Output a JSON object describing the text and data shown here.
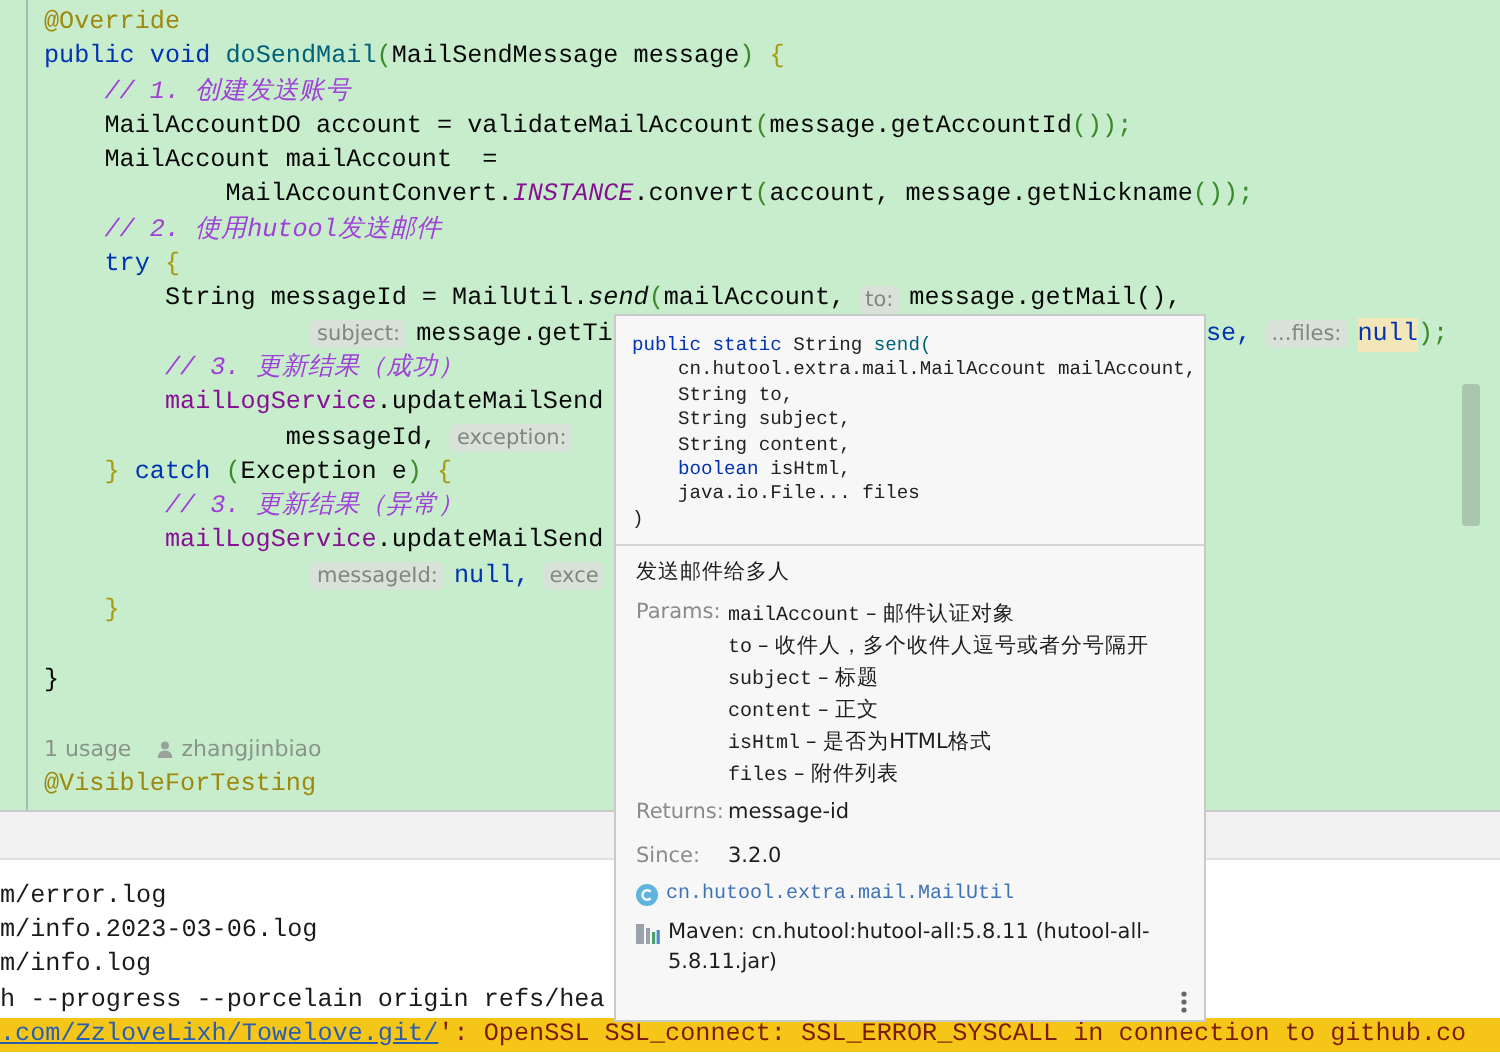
{
  "editor": {
    "lines": [
      {
        "kind": "top",
        "tokens": [
          {
            "kind": "annotation",
            "text": "@Override"
          }
        ]
      },
      {
        "kind": "top",
        "tokens": [
          {
            "kind": "keyword",
            "text": "public void "
          },
          {
            "kind": "method",
            "text": "doSendMail"
          },
          {
            "kind": "paren",
            "text": "("
          },
          {
            "kind": "plain",
            "text": "MailSendMessage message"
          },
          {
            "kind": "paren",
            "text": ")"
          },
          {
            "kind": "brace",
            "text": " {"
          }
        ]
      },
      {
        "kind": "block",
        "tokens": [
          {
            "kind": "comment",
            "text": "// 1. 创建发送账号"
          }
        ]
      },
      {
        "kind": "block",
        "tokens": [
          {
            "kind": "plain",
            "text": "MailAccountDO account = validateMailAccount"
          },
          {
            "kind": "paren",
            "text": "("
          },
          {
            "kind": "plain",
            "text": "message.getAccountId"
          },
          {
            "kind": "paren",
            "text": "());"
          }
        ]
      },
      {
        "kind": "block",
        "tokens": [
          {
            "kind": "plain",
            "text": "MailAccount mailAccount  ="
          }
        ]
      },
      {
        "kind": "continuation",
        "tokens": [
          {
            "kind": "plain",
            "text": "MailAccountConvert."
          },
          {
            "kind": "static",
            "text": "INSTANCE"
          },
          {
            "kind": "plain",
            "text": ".convert"
          },
          {
            "kind": "paren",
            "text": "("
          },
          {
            "kind": "plain",
            "text": "account, message.getNickname"
          },
          {
            "kind": "paren",
            "text": "());"
          }
        ]
      },
      {
        "kind": "block",
        "tokens": [
          {
            "kind": "comment",
            "text": "// 2. 使用hutool发送邮件"
          }
        ]
      },
      {
        "kind": "block",
        "tokens": [
          {
            "kind": "keyword",
            "text": "try"
          },
          {
            "kind": "brace",
            "text": " {"
          }
        ]
      },
      {
        "kind": "nested",
        "tokens": [
          {
            "kind": "plain",
            "text": "String messageId = MailUtil."
          },
          {
            "kind": "call",
            "text": "send"
          },
          {
            "kind": "paren",
            "text": "("
          },
          {
            "kind": "plain",
            "text": "mailAccount,"
          },
          {
            "kind": "hint",
            "text": "to:"
          },
          {
            "kind": "plain",
            "text": "message.getMail(),"
          }
        ]
      },
      {
        "kind": "hinted",
        "tokens": [
          {
            "kind": "hint",
            "text": "subject:"
          },
          {
            "kind": "plain",
            "text": "message.getTi"
          }
        ],
        "tail": [
          {
            "kind": "keyword",
            "text": "se,"
          },
          {
            "kind": "hint",
            "text": "...files:"
          },
          {
            "kind": "null",
            "text": "null"
          },
          {
            "kind": "paren",
            "text": ");"
          }
        ]
      },
      {
        "kind": "nested",
        "tokens": [
          {
            "kind": "comment",
            "text": "// 3. 更新结果（成功）"
          }
        ]
      },
      {
        "kind": "nested",
        "tokens": [
          {
            "kind": "field",
            "text": "mailLogService"
          },
          {
            "kind": "plain",
            "text": ".updateMailSend"
          }
        ]
      },
      {
        "kind": "wrapped",
        "tokens": [
          {
            "kind": "plain",
            "text": "messageId,"
          },
          {
            "kind": "hint",
            "text": "exception:"
          }
        ]
      },
      {
        "kind": "block",
        "tokens": [
          {
            "kind": "brace",
            "text": "} "
          },
          {
            "kind": "keyword",
            "text": "catch "
          },
          {
            "kind": "paren",
            "text": "("
          },
          {
            "kind": "plain",
            "text": "Exception e"
          },
          {
            "kind": "paren",
            "text": ")"
          },
          {
            "kind": "brace",
            "text": " {"
          }
        ]
      },
      {
        "kind": "nested",
        "tokens": [
          {
            "kind": "comment",
            "text": "// 3. 更新结果（异常）"
          }
        ]
      },
      {
        "kind": "nested",
        "tokens": [
          {
            "kind": "field",
            "text": "mailLogService"
          },
          {
            "kind": "plain",
            "text": ".updateMailSend"
          }
        ]
      },
      {
        "kind": "hinted",
        "tokens": [
          {
            "kind": "hint",
            "text": "messageId:"
          },
          {
            "kind": "keyword",
            "text": "null,"
          },
          {
            "kind": "hint",
            "text": "exce"
          }
        ]
      },
      {
        "kind": "block",
        "tokens": [
          {
            "kind": "brace",
            "text": "}"
          }
        ]
      },
      {
        "kind": "blank"
      },
      {
        "kind": "top",
        "tokens": [
          {
            "kind": "plain",
            "text": "}"
          }
        ]
      },
      {
        "kind": "blank"
      },
      {
        "kind": "usage",
        "usage": "1 usage",
        "author": "zhangjinbiao"
      },
      {
        "kind": "top",
        "tokens": [
          {
            "kind": "annotation",
            "text": "@VisibleForTesting"
          }
        ]
      }
    ]
  },
  "doc_popup": {
    "signature": [
      {
        "kind": "top",
        "tokens": [
          {
            "kind": "keyword",
            "text": "public static "
          },
          {
            "kind": "plain",
            "text": "String "
          },
          {
            "kind": "method",
            "text": "send("
          }
        ]
      },
      {
        "kind": "block",
        "tokens": [
          {
            "kind": "plain",
            "text": "cn.hutool.extra.mail.MailAccount mailAccount,"
          }
        ]
      },
      {
        "kind": "block",
        "tokens": [
          {
            "kind": "plain",
            "text": "String to,"
          }
        ]
      },
      {
        "kind": "block",
        "tokens": [
          {
            "kind": "plain",
            "text": "String subject,"
          }
        ]
      },
      {
        "kind": "block",
        "tokens": [
          {
            "kind": "plain",
            "text": "String content,"
          }
        ]
      },
      {
        "kind": "block",
        "tokens": [
          {
            "kind": "keyword",
            "text": "boolean "
          },
          {
            "kind": "plain",
            "text": "isHtml,"
          }
        ]
      },
      {
        "kind": "block",
        "tokens": [
          {
            "kind": "plain",
            "text": "java.io.File... files"
          }
        ]
      },
      {
        "kind": "top",
        "tokens": [
          {
            "kind": "plain",
            "text": ")"
          }
        ]
      }
    ],
    "description": "发送邮件给多人",
    "params_label": "Params:",
    "params": [
      {
        "name": "mailAccount",
        "description": "– 邮件认证对象"
      },
      {
        "name": "to",
        "description": "– 收件人，多个收件人逗号或者分号隔开"
      },
      {
        "name": "subject",
        "description": "– 标题"
      },
      {
        "name": "content",
        "description": "– 正文"
      },
      {
        "name": "isHtml",
        "description": "– 是否为HTML格式"
      },
      {
        "name": "files",
        "description": "– 附件列表"
      }
    ],
    "returns_label": "Returns:",
    "returns": "message-id",
    "since_label": "Since:",
    "since": "3.2.0",
    "class_link": "cn.hutool.extra.mail.MailUtil",
    "library": "Maven: cn.hutool:hutool-all:5.8.11 (hutool-all-5.8.11.jar)"
  },
  "terminal": {
    "lines": [
      {
        "kind": "plain",
        "text": "m/error.log"
      },
      {
        "kind": "plain",
        "text": "m/info.2023-03-06.log"
      },
      {
        "kind": "plain",
        "text": "m/info.log"
      },
      {
        "kind": "plain",
        "text": "h --progress --porcelain origin refs/hea"
      },
      {
        "kind": "error",
        "link": ".com/ZzloveLixh/Towelove.git/",
        "text": "': OpenSSL SSL_connect: SSL_ERROR_SYSCALL in connection to github.co"
      }
    ]
  }
}
